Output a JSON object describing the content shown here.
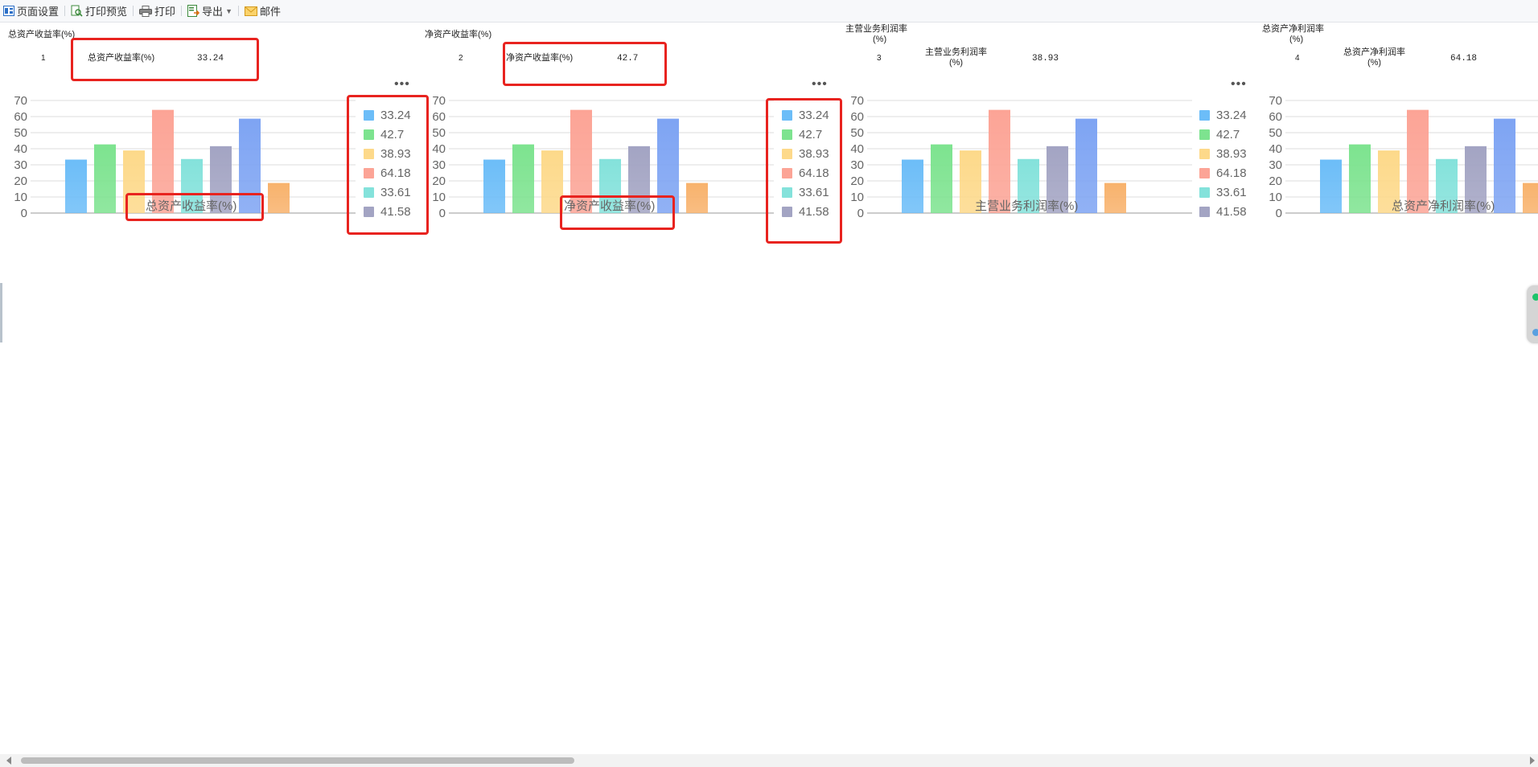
{
  "toolbar": {
    "page_setup": "页面设置",
    "print_preview": "打印预览",
    "print": "打印",
    "export": "导出",
    "mail": "邮件"
  },
  "panels": [
    {
      "title": "总资产收益率(%)",
      "row_number": "1",
      "label": "总资产收益率(%)",
      "value": "33.24",
      "axis_title": "总资产收益率(%)"
    },
    {
      "title": "净资产收益率(%)",
      "row_number": "2",
      "label": "净资产收益率(%)",
      "value": "42.7",
      "axis_title": "净资产收益率(%)"
    },
    {
      "title": "主营业务利润率",
      "title_unit": "(%)",
      "row_number": "3",
      "label": "主营业务利润率",
      "label_unit": "(%)",
      "value": "38.93",
      "axis_title": "主营业务利润率(%)"
    },
    {
      "title": "总资产净利润率",
      "title_unit": "(%)",
      "row_number": "4",
      "label": "总资产净利润率",
      "label_unit": "(%)",
      "value": "64.18",
      "axis_title": "总资产净利润率(%)"
    }
  ],
  "more_glyph": "•••",
  "chart_data": {
    "type": "bar",
    "categories": [
      "33.24",
      "42.7",
      "38.93",
      "64.18",
      "33.61",
      "41.58",
      "58.7",
      "18.7"
    ],
    "values": [
      33.24,
      42.7,
      38.93,
      64.18,
      33.61,
      41.58,
      58.7,
      18.7
    ],
    "legend_visible": [
      "33.24",
      "42.7",
      "38.93",
      "64.18",
      "33.61",
      "41.58"
    ],
    "colors": [
      "#6cbdf8",
      "#7de38f",
      "#fdd98a",
      "#fca496",
      "#84e2db",
      "#a3a4c3",
      "#7ea4f3",
      "#f8b26c"
    ],
    "yticks": [
      0,
      10,
      20,
      30,
      40,
      50,
      60,
      70
    ],
    "ylim": [
      0,
      70
    ],
    "grid": true,
    "legend_position": "right"
  },
  "highlight_color": "#e8231f"
}
